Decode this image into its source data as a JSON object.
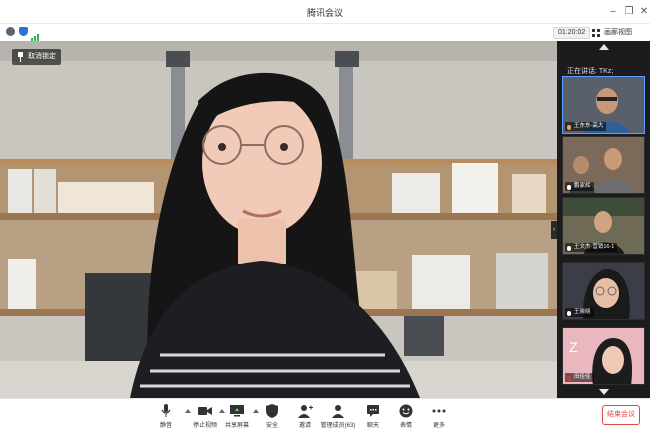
{
  "window": {
    "title": "腾讯会议"
  },
  "info_bar": {
    "timer": "01:20:02",
    "gallery_view_label": "画廊视图"
  },
  "video": {
    "unpin_label": "取消锁定"
  },
  "panel": {
    "speaking_label": "正在讲话: TKz;",
    "participants": [
      {
        "name": "王东东-高大",
        "mic": "on"
      },
      {
        "name": "鹏家辉",
        "mic": "on"
      },
      {
        "name": "王文杰-营销16-1",
        "mic": "on"
      },
      {
        "name": "王晓晓",
        "mic": "on"
      },
      {
        "name": "田佳佳",
        "mic": "muted"
      }
    ]
  },
  "toolbar": {
    "mute_label": "静音",
    "stop_video_label": "停止视频",
    "share_screen_label": "共享屏幕",
    "security_label": "安全",
    "invite_label": "邀请",
    "manage_members_label": "管理成员(63)",
    "chat_label": "聊天",
    "reactions_label": "表情",
    "more_label": "更多",
    "end_meeting_label": "结束会议"
  },
  "colors": {
    "end_button": "#e04a45",
    "signal": "#33b34a",
    "info": "#2f6fd6"
  }
}
